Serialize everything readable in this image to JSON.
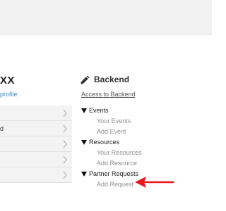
{
  "profile": {
    "name_partial": "XX",
    "profile_link_partial": "profile"
  },
  "left_menu": {
    "items": [
      {
        "label": ""
      },
      {
        "label": "d"
      },
      {
        "label": ""
      },
      {
        "label": ""
      },
      {
        "label": ""
      }
    ]
  },
  "backend": {
    "title": "Backend",
    "icon": "pencil-icon",
    "access_link": "Access to Backend",
    "sections": [
      {
        "label": "Events",
        "items": [
          "Your Events",
          "Add Event"
        ]
      },
      {
        "label": "Resources",
        "items": [
          "Your Resources",
          "Add Resource"
        ]
      },
      {
        "label": "Partner Requests",
        "items": [
          "Add Request"
        ]
      }
    ]
  },
  "annotation": {
    "arrow_color": "#e8161b",
    "arrow_icon": "left-arrow-icon"
  },
  "colors": {
    "link": "#3a8dc6",
    "topbar": "#f2f2f2",
    "menu_bg": "#f3f3f3"
  }
}
